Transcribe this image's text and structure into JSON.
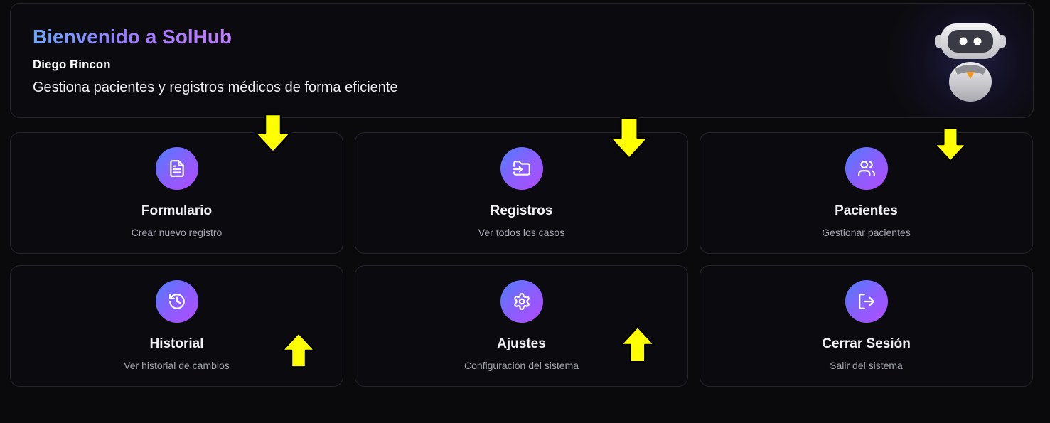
{
  "header": {
    "title": "Bienvenido a SolHub",
    "user_name": "Diego Rincon",
    "description": "Gestiona pacientes y registros médicos de forma eficiente",
    "mascot_icon": "robot-icon"
  },
  "cards": [
    {
      "title": "Formulario",
      "subtitle": "Crear nuevo registro",
      "icon": "document-icon"
    },
    {
      "title": "Registros",
      "subtitle": "Ver todos los casos",
      "icon": "folder-input-icon"
    },
    {
      "title": "Pacientes",
      "subtitle": "Gestionar pacientes",
      "icon": "users-icon"
    },
    {
      "title": "Historial",
      "subtitle": "Ver historial de cambios",
      "icon": "history-icon"
    },
    {
      "title": "Ajustes",
      "subtitle": "Configuración del sistema",
      "icon": "gear-icon"
    },
    {
      "title": "Cerrar Sesión",
      "subtitle": "Salir del sistema",
      "icon": "logout-icon"
    }
  ],
  "annotations": {
    "arrow_color": "#ffff00",
    "arrow_outline": "#000000"
  },
  "colors": {
    "background": "#0a0a0d",
    "card_background": "#0b0b0f",
    "card_border": "#24242b",
    "accent_gradient_start": "#4f7dff",
    "accent_gradient_end": "#b14dff",
    "title_gradient_start": "#6aa7ff",
    "title_gradient_end": "#c27cff"
  }
}
